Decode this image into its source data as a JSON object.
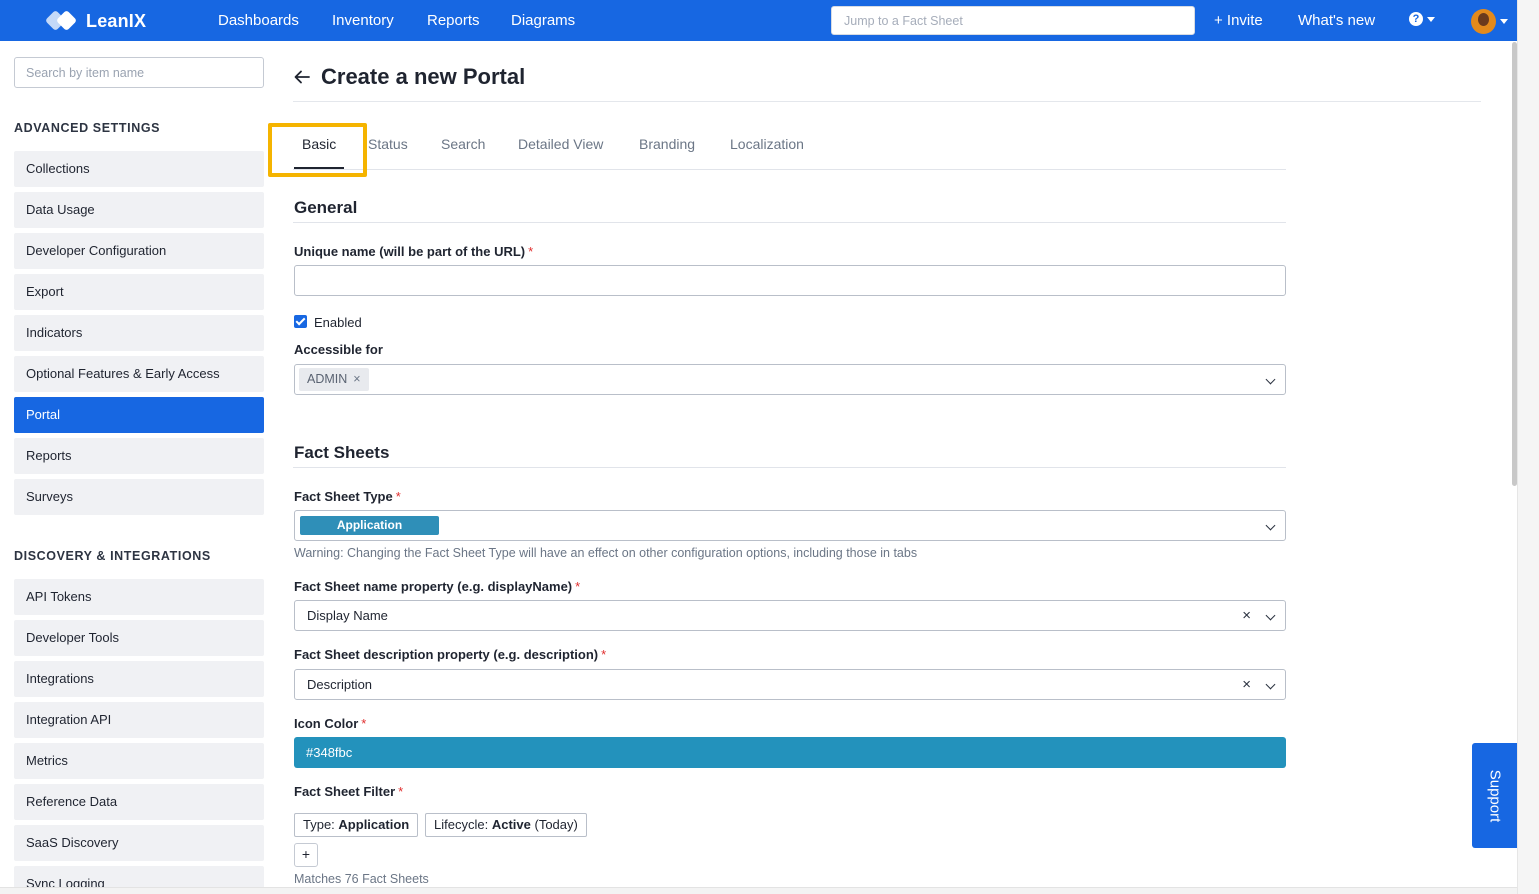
{
  "topbar": {
    "logo": "LeanIX",
    "nav": [
      "Dashboards",
      "Inventory",
      "Reports",
      "Diagrams"
    ],
    "search_placeholder": "Jump to a Fact Sheet",
    "invite": "+ Invite",
    "whats_new": "What's new",
    "help_glyph": "?"
  },
  "sidebar": {
    "search_placeholder": "Search by item name",
    "advanced_heading": "ADVANCED SETTINGS",
    "advanced_items": [
      "Collections",
      "Data Usage",
      "Developer Configuration",
      "Export",
      "Indicators",
      "Optional Features & Early Access",
      "Portal",
      "Reports",
      "Surveys"
    ],
    "active_item": "Portal",
    "discovery_heading": "DISCOVERY & INTEGRATIONS",
    "discovery_items": [
      "API Tokens",
      "Developer Tools",
      "Integrations",
      "Integration API",
      "Metrics",
      "Reference Data",
      "SaaS Discovery",
      "Sync Logging"
    ]
  },
  "page": {
    "title": "Create a new Portal",
    "tabs": [
      "Basic",
      "Status",
      "Search",
      "Detailed View",
      "Branding",
      "Localization"
    ],
    "active_tab": "Basic"
  },
  "general": {
    "heading": "General",
    "unique_name_label": "Unique name (will be part of the URL)",
    "unique_name_value": "",
    "required_mark": "*",
    "enabled_label": "Enabled",
    "enabled_checked": true,
    "accessible_label": "Accessible for",
    "accessible_tag": "ADMIN",
    "tag_remove": "×"
  },
  "factsheets": {
    "heading": "Fact Sheets",
    "type_label": "Fact Sheet Type",
    "type_value": "Application",
    "type_color": "#2f8fb8",
    "warning": "Warning: Changing the Fact Sheet Type will have an effect on other configuration options, including those in tabs",
    "name_prop_label": "Fact Sheet name property (e.g. displayName)",
    "name_prop_value": "Display Name",
    "desc_prop_label": "Fact Sheet description property (e.g. description)",
    "desc_prop_value": "Description",
    "clear_glyph": "×",
    "icon_color_label": "Icon Color",
    "icon_color_value": "#348fbc",
    "filter_label": "Fact Sheet Filter",
    "filter_type_key": "Type:",
    "filter_type_val": "Application",
    "filter_lifecycle_key": "Lifecycle:",
    "filter_lifecycle_val": "Active",
    "filter_lifecycle_suffix": "(Today)",
    "add_filter": "+",
    "matches": "Matches 76 Fact Sheets"
  },
  "support": "Support",
  "colors": {
    "brand": "#1767e2",
    "highlight": "#f5b400",
    "icon_color_swatch": "#2392bc"
  }
}
